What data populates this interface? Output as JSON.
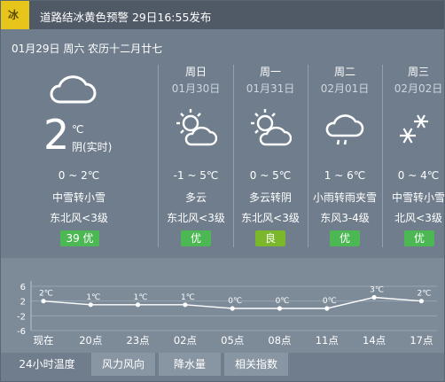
{
  "alert": {
    "badge": "冰",
    "text": "道路结冰黄色预警 29日16:55发布",
    "color": "#e8c51a"
  },
  "date_line": "01月29日 周六 农历十二月廿七",
  "today": {
    "temp": "2",
    "unit": "℃",
    "desc": "阴(实时)",
    "range": "0 ~ 2℃",
    "weather": "中雪转小雪",
    "wind": "东北风<3级",
    "aqi": "39 优",
    "icon": "cloud-icon"
  },
  "days": [
    {
      "name": "周日",
      "date": "01月30日",
      "icon": "sun-cloud-icon",
      "range": "-1 ~ 5℃",
      "weather": "多云",
      "wind": "东北风<3级",
      "aqi": "优"
    },
    {
      "name": "周一",
      "date": "01月31日",
      "icon": "sun-cloud-icon",
      "range": "0 ~ 5℃",
      "weather": "多云转阴",
      "wind": "东北风<3级",
      "aqi": "良"
    },
    {
      "name": "周二",
      "date": "02月01日",
      "icon": "rain-cloud-icon",
      "range": "1 ~ 6℃",
      "weather": "小雨转雨夹雪",
      "wind": "东风3-4级",
      "aqi": "优"
    },
    {
      "name": "周三",
      "date": "02月02日",
      "icon": "snowflake-icon",
      "range": "0 ~ 4℃",
      "weather": "中雪转小雪",
      "wind": "北风<3级",
      "aqi": "优"
    }
  ],
  "tabs": [
    "24小时温度",
    "风力风向",
    "降水量",
    "相关指数"
  ],
  "chart_data": {
    "type": "line",
    "categories": [
      "现在",
      "20点",
      "23点",
      "02点",
      "05点",
      "08点",
      "11点",
      "14点",
      "17点"
    ],
    "values": [
      2,
      1,
      1,
      1,
      0,
      0,
      0,
      3,
      2
    ],
    "labels": [
      "2℃",
      "1℃",
      "1℃",
      "1℃",
      "0℃",
      "0℃",
      "0℃",
      "3℃",
      "2℃"
    ],
    "yticks": [
      "6",
      "2",
      "-2",
      "-6"
    ],
    "ylim": [
      -6,
      6
    ],
    "grid": true
  }
}
